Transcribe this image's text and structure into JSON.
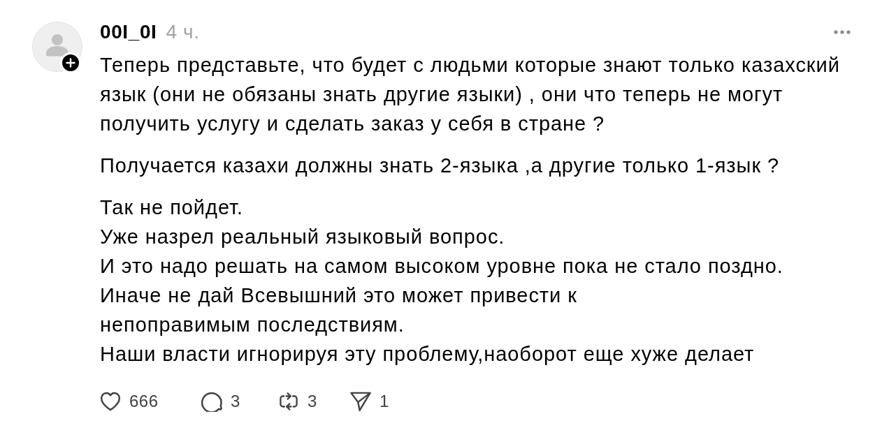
{
  "post": {
    "author": {
      "username": "00I_0I",
      "time": "4 ч."
    },
    "paragraphs": [
      {
        "lines": [
          "Теперь представьте, что будет с людьми которые знают только казахский",
          "язык (они не обязаны знать другие языки) , они что теперь не могут",
          "получить услугу и сделать заказ у себя в стране ?"
        ]
      },
      {
        "lines": [
          "Получается казахи должны знать 2-языка ,а другие только 1-язык ?"
        ]
      },
      {
        "lines": [
          "Так не пойдет.",
          "Уже назрел реальный языковый вопрос.",
          "И это надо решать на самом высоком уровне пока не стало поздно.",
          "Иначе не дай Всевышний это может привести к",
          "непоправимым последствиям.",
          "Наши власти игнорируя эту проблему,наоборот еще хуже делает"
        ]
      }
    ],
    "actions": [
      {
        "kind": "like",
        "count": "666"
      },
      {
        "kind": "reply",
        "count": "3"
      },
      {
        "kind": "repost",
        "count": "3"
      },
      {
        "kind": "share",
        "count": "1"
      }
    ]
  }
}
